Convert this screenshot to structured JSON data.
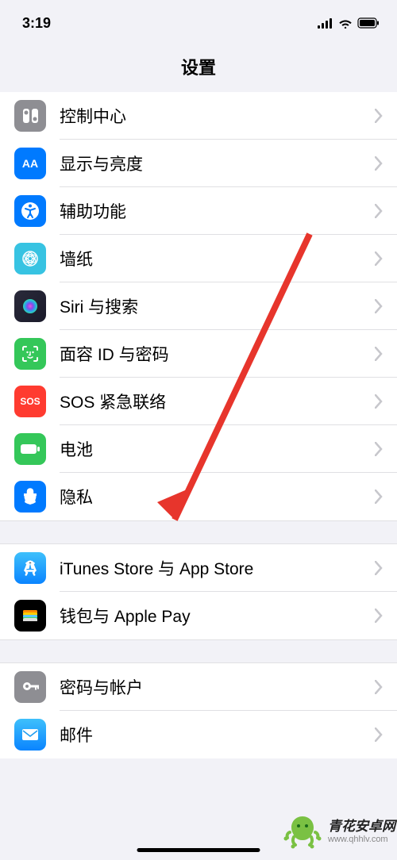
{
  "status": {
    "time": "3:19"
  },
  "header": {
    "title": "设置"
  },
  "sections": [
    {
      "rows": [
        {
          "id": "control-center",
          "label": "控制中心",
          "icon": "control-center-icon"
        },
        {
          "id": "display",
          "label": "显示与亮度",
          "icon": "display-icon"
        },
        {
          "id": "accessibility",
          "label": "辅助功能",
          "icon": "accessibility-icon"
        },
        {
          "id": "wallpaper",
          "label": "墙纸",
          "icon": "wallpaper-icon"
        },
        {
          "id": "siri",
          "label": "Siri 与搜索",
          "icon": "siri-icon"
        },
        {
          "id": "faceid",
          "label": "面容 ID 与密码",
          "icon": "faceid-icon"
        },
        {
          "id": "sos",
          "label": "SOS 紧急联络",
          "icon": "sos-icon"
        },
        {
          "id": "battery",
          "label": "电池",
          "icon": "battery-icon"
        },
        {
          "id": "privacy",
          "label": "隐私",
          "icon": "privacy-icon"
        }
      ]
    },
    {
      "rows": [
        {
          "id": "itunes",
          "label": "iTunes Store 与 App Store",
          "icon": "app-store-icon"
        },
        {
          "id": "wallet",
          "label": "钱包与 Apple Pay",
          "icon": "wallet-icon"
        }
      ]
    },
    {
      "rows": [
        {
          "id": "passwords",
          "label": "密码与帐户",
          "icon": "key-icon"
        },
        {
          "id": "mail",
          "label": "邮件",
          "icon": "mail-icon"
        }
      ]
    }
  ],
  "watermark": {
    "title": "青花安卓网",
    "url": "www.qhhlv.com"
  }
}
